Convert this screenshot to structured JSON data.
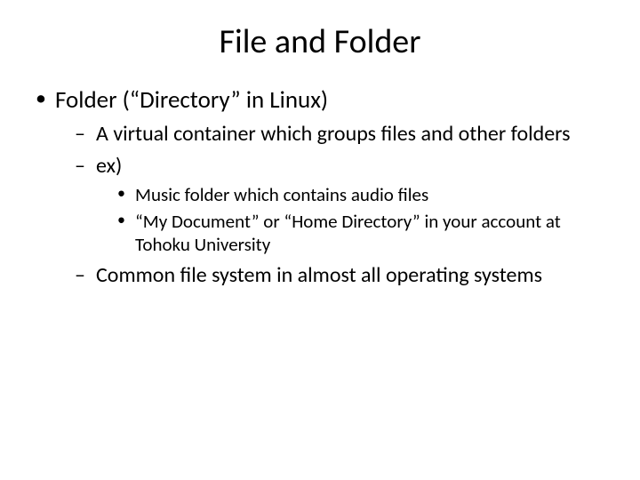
{
  "title": "File and Folder",
  "bullets": {
    "l1": "Folder (“Directory” in Linux)",
    "l2a": "A virtual container which groups files and other folders",
    "l2b": "ex)",
    "l3a": "Music folder which contains audio files",
    "l3b": "“My Document” or “Home Directory” in your account at Tohoku University",
    "l2c": "Common file system in almost all operating systems"
  }
}
